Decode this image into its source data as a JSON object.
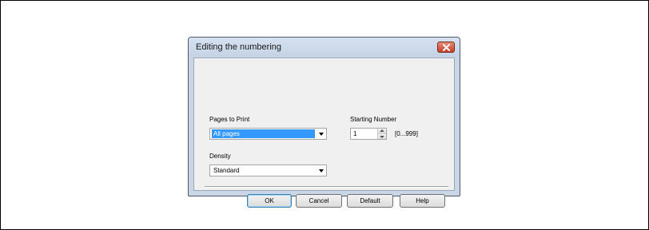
{
  "dialog": {
    "title": "Editing the numbering",
    "close_icon": "close-icon"
  },
  "pages_to_print": {
    "label": "Pages to Print",
    "selected": "All pages"
  },
  "starting_number": {
    "label": "Starting Number",
    "value": "1",
    "range": "[0...999]"
  },
  "density": {
    "label": "Density",
    "selected": "Standard"
  },
  "buttons": {
    "ok": "OK",
    "cancel": "Cancel",
    "default": "Default",
    "help": "Help"
  },
  "colors": {
    "selection": "#3399ff",
    "close_button": "#c7412a",
    "dialog_frame": "#c9d6e6"
  }
}
